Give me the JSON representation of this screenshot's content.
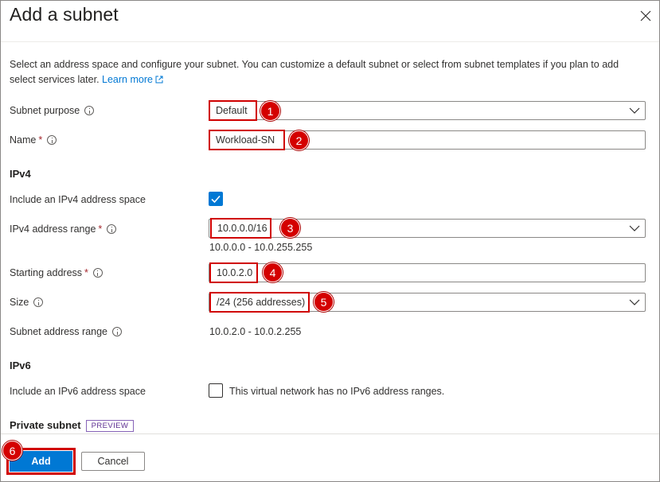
{
  "panel": {
    "title": "Add a subnet",
    "description": "Select an address space and configure your subnet. You can customize a default subnet or select from subnet templates if you plan to add select services later.",
    "learn_more": "Learn more"
  },
  "form": {
    "subnet_purpose_label": "Subnet purpose",
    "subnet_purpose_value": "Default",
    "name_label": "Name",
    "name_value": "Workload-SN",
    "required_mark": "*",
    "ipv4_section": "IPv4",
    "include_ipv4_label": "Include an IPv4 address space",
    "include_ipv4_checked": true,
    "ipv4_range_label": "IPv4 address range",
    "ipv4_range_value": "10.0.0.0/16",
    "ipv4_range_hint": "10.0.0.0 - 10.0.255.255",
    "starting_address_label": "Starting address",
    "starting_address_value": "10.0.2.0",
    "size_label": "Size",
    "size_value": "/24 (256 addresses)",
    "subnet_range_label": "Subnet address range",
    "subnet_range_value": "10.0.2.0 - 10.0.2.255",
    "ipv6_section": "IPv6",
    "include_ipv6_label": "Include an IPv6 address space",
    "include_ipv6_checked": false,
    "ipv6_note": "This virtual network has no IPv6 address ranges.",
    "private_subnet_label": "Private subnet",
    "preview_tag": "PREVIEW"
  },
  "callouts": [
    "1",
    "2",
    "3",
    "4",
    "5",
    "6"
  ],
  "footer": {
    "add_label": "Add",
    "cancel_label": "Cancel"
  },
  "colors": {
    "accent": "#0078d4",
    "callout_red": "#d00000",
    "preview_purple": "#8764b8"
  }
}
